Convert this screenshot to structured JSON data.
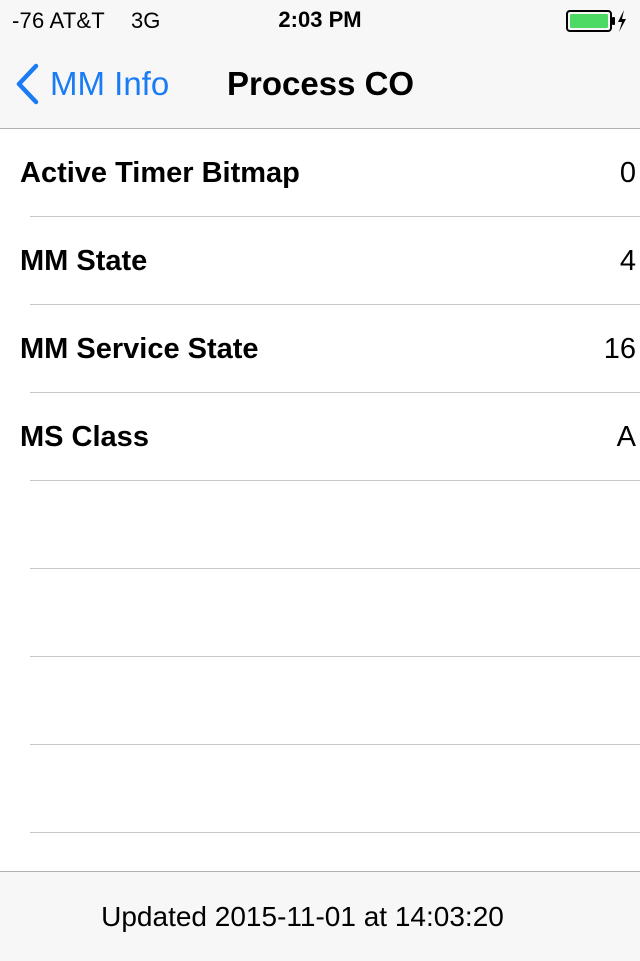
{
  "status_bar": {
    "carrier": "-76 AT&T",
    "network": "3G",
    "time": "2:03 PM",
    "battery_level": 1.0,
    "charging": true,
    "battery_color": "#4cd964"
  },
  "nav": {
    "back_label": "MM Info",
    "title": "Process CO",
    "accent_color": "#1a7cf5"
  },
  "rows": [
    {
      "label": "Active Timer Bitmap",
      "value": "0"
    },
    {
      "label": "MM State",
      "value": "4"
    },
    {
      "label": "MM Service State",
      "value": "16"
    },
    {
      "label": "MS Class",
      "value": "A"
    },
    {
      "label": "",
      "value": ""
    },
    {
      "label": "",
      "value": ""
    },
    {
      "label": "",
      "value": ""
    },
    {
      "label": "",
      "value": ""
    }
  ],
  "footer": {
    "updated_text": "Updated 2015-11-01 at 14:03:20"
  }
}
